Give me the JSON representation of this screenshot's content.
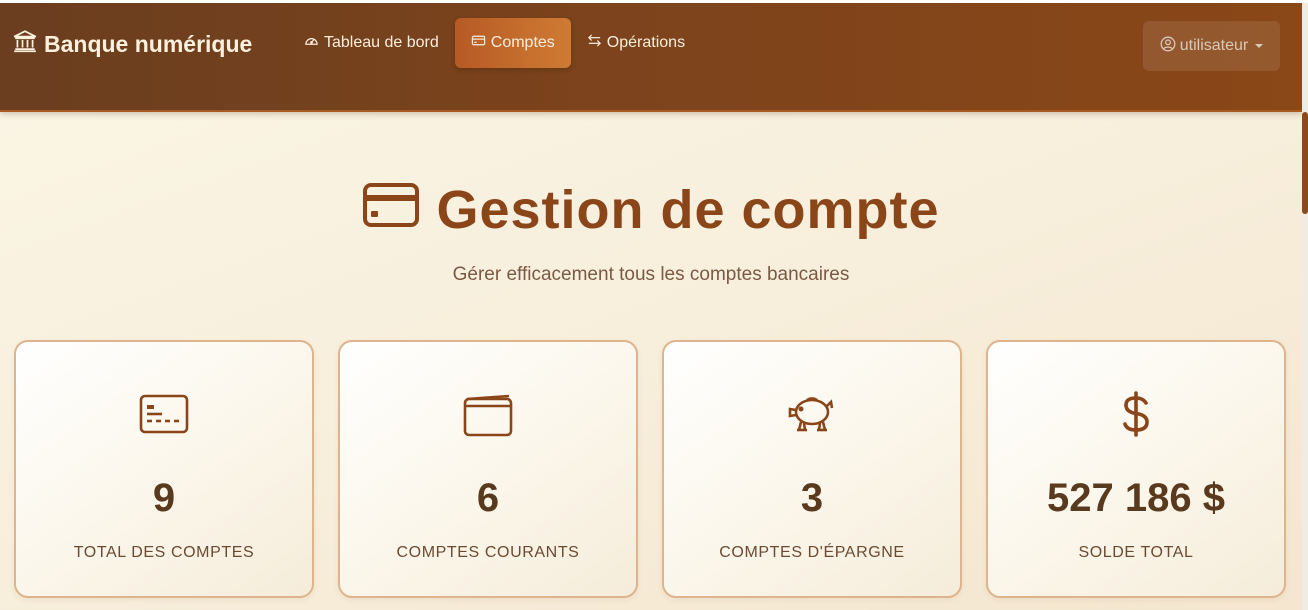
{
  "brand": {
    "name": "Banque numérique",
    "icon": "bank-icon"
  },
  "nav": {
    "items": [
      {
        "label": "Tableau de bord",
        "icon": "speedometer-icon",
        "active": false
      },
      {
        "label": "Comptes",
        "icon": "credit-card-icon",
        "active": true
      },
      {
        "label": "Opérations",
        "icon": "arrows-exchange-icon",
        "active": false
      }
    ]
  },
  "user": {
    "label": "utilisateur",
    "icon": "user-circle-icon"
  },
  "hero": {
    "title": "Gestion de compte",
    "subtitle": "Gérer efficacement tous les comptes bancaires",
    "icon": "credit-card-icon"
  },
  "stats": [
    {
      "value": "9",
      "label": "TOTAL DES COMPTES",
      "icon": "card-details-icon"
    },
    {
      "value": "6",
      "label": "COMPTES COURANTS",
      "icon": "wallet-icon"
    },
    {
      "value": "3",
      "label": "COMPTES D'ÉPARGNE",
      "icon": "piggy-bank-icon"
    },
    {
      "value": "527 186 $",
      "label": "SOLDE TOTAL",
      "icon": "dollar-icon"
    }
  ],
  "colors": {
    "navbar_start": "#6a3e1f",
    "navbar_end": "#8a4717",
    "accent": "#cf7b33",
    "title": "#8a4518",
    "card_border": "#dcb48e"
  }
}
